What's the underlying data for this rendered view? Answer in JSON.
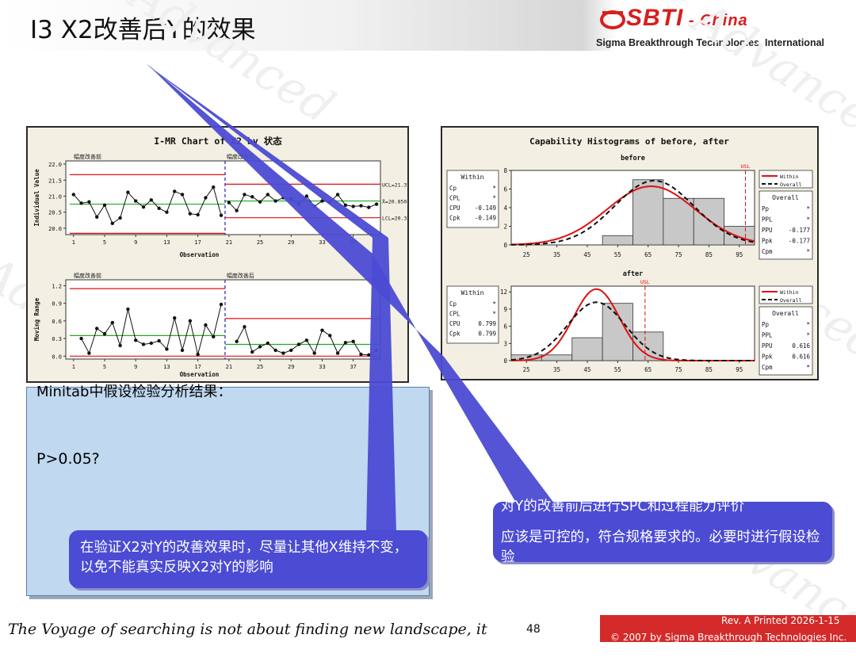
{
  "header": {
    "title": "I3  X2改善后Y的效果",
    "logo_brand": "SBTI",
    "logo_suffix": " - China",
    "logo_subtitle": "Sigma Breakthrough Technologies, International"
  },
  "watermark_text": "Advanced",
  "chart_data": [
    {
      "type": "line",
      "title": "I-MR Chart of X2 by 状态",
      "panels": [
        {
          "name": "individual",
          "ylabel": "Individual Value",
          "xlabel": "Observation",
          "ylim": [
            19.8,
            22.1
          ],
          "yticks": [
            20.0,
            20.5,
            21.0,
            21.5,
            22.0
          ],
          "xticks": [
            1,
            5,
            9,
            13,
            17,
            21,
            25,
            29,
            33,
            37
          ],
          "stage_labels": [
            "幅度改善前",
            "幅度改善后"
          ],
          "stage_split": 20.5,
          "x": [
            1,
            2,
            3,
            4,
            5,
            6,
            7,
            8,
            9,
            10,
            11,
            12,
            13,
            14,
            15,
            16,
            17,
            18,
            19,
            20,
            21,
            22,
            23,
            24,
            25,
            26,
            27,
            28,
            29,
            30,
            31,
            32,
            33,
            34,
            35,
            36,
            37,
            38,
            39,
            40
          ],
          "values": [
            21.05,
            20.78,
            20.82,
            20.35,
            20.72,
            20.15,
            20.32,
            21.12,
            20.85,
            20.66,
            20.88,
            20.62,
            20.5,
            21.15,
            21.05,
            20.45,
            20.42,
            20.95,
            21.28,
            20.4,
            20.8,
            20.55,
            21.05,
            20.98,
            20.82,
            21.05,
            20.85,
            20.95,
            20.92,
            20.75,
            21.0,
            20.68,
            20.85,
            20.82,
            21.05,
            20.72,
            20.68,
            20.7,
            20.65,
            20.75
          ],
          "control_limits": {
            "before": {
              "ucl": 21.67,
              "center": 20.75,
              "lcl": 19.84
            },
            "after": {
              "ucl": 21.373,
              "center": 20.85,
              "lcl": 20.327
            }
          },
          "limit_labels": [
            "UCL=21.373",
            "X̄=20.850",
            "LCL=20.327"
          ]
        },
        {
          "name": "moving_range",
          "ylabel": "Moving Range",
          "xlabel": "Observation",
          "ylim": [
            -0.05,
            1.3
          ],
          "yticks": [
            0.0,
            0.3,
            0.6,
            0.9,
            1.2
          ],
          "xticks": [
            1,
            5,
            9,
            13,
            17,
            21,
            25,
            29,
            33,
            37
          ],
          "stage_labels": [
            "幅度改善前",
            "幅度改善后"
          ],
          "stage_split": 20.5,
          "x": [
            2,
            3,
            4,
            5,
            6,
            7,
            8,
            9,
            10,
            11,
            12,
            13,
            14,
            15,
            16,
            17,
            18,
            19,
            20,
            22,
            23,
            24,
            25,
            26,
            27,
            28,
            29,
            30,
            31,
            32,
            33,
            34,
            35,
            36,
            37,
            38,
            39,
            40
          ],
          "values": [
            0.3,
            0.05,
            0.47,
            0.38,
            0.57,
            0.18,
            0.8,
            0.27,
            0.2,
            0.22,
            0.26,
            0.12,
            0.65,
            0.1,
            0.6,
            0.03,
            0.53,
            0.33,
            0.88,
            0.25,
            0.5,
            0.07,
            0.16,
            0.22,
            0.1,
            0.05,
            0.1,
            0.2,
            0.27,
            0.05,
            0.44,
            0.35,
            0.05,
            0.23,
            0.25,
            0.03,
            0.02,
            0.1
          ],
          "control_limits": {
            "before": {
              "ucl": 1.15,
              "center": 0.35,
              "lcl": 0.0
            },
            "after": {
              "ucl": 0.64,
              "center": 0.2,
              "lcl": 0.0
            }
          }
        }
      ]
    },
    {
      "type": "bar",
      "title": "Capability Histograms of before, after",
      "xticks": [
        25,
        35,
        45,
        55,
        65,
        75,
        85,
        95
      ],
      "xlim": [
        20,
        100
      ],
      "panels": [
        {
          "name": "before",
          "usl": 97,
          "usl_label": "USL",
          "ylim": [
            0,
            8
          ],
          "yticks": [
            0,
            2,
            4,
            6,
            8
          ],
          "bin_edges": [
            40,
            50,
            60,
            70,
            80,
            90,
            100
          ],
          "counts": [
            0,
            1,
            7,
            5,
            5,
            2
          ],
          "within_stats": [
            [
              "Cp",
              "*"
            ],
            [
              "CPL",
              "*"
            ],
            [
              "CPU",
              "-0.149"
            ],
            [
              "Cpk",
              "-0.149"
            ]
          ],
          "overall_stats": [
            [
              "Pp",
              "*"
            ],
            [
              "PPL",
              "*"
            ],
            [
              "PPU",
              "-0.177"
            ],
            [
              "Ppk",
              "-0.177"
            ],
            [
              "Cpm",
              "*"
            ]
          ],
          "within_curve": {
            "mean": 66,
            "sd": 14.5,
            "peak": 6.3
          },
          "overall_curve": {
            "mean": 67,
            "sd": 13,
            "peak": 6.9
          }
        },
        {
          "name": "after",
          "usl": 64,
          "usl_label": "USL",
          "ylim": [
            0,
            13
          ],
          "yticks": [
            0,
            3,
            6,
            9,
            12
          ],
          "bin_edges": [
            20,
            30,
            40,
            50,
            60,
            70
          ],
          "counts": [
            1,
            1,
            4,
            10,
            5
          ],
          "within_stats": [
            [
              "Cp",
              "*"
            ],
            [
              "CPL",
              "*"
            ],
            [
              "CPU",
              "0.799"
            ],
            [
              "Cpk",
              "0.799"
            ]
          ],
          "overall_stats": [
            [
              "Pp",
              "*"
            ],
            [
              "PPL",
              "*"
            ],
            [
              "PPU",
              "0.616"
            ],
            [
              "Ppk",
              "0.616"
            ],
            [
              "Cpm",
              "*"
            ]
          ],
          "within_curve": {
            "mean": 48,
            "sd": 7.5,
            "peak": 12.5
          },
          "overall_curve": {
            "mean": 48,
            "sd": 9.5,
            "peak": 10.2
          }
        }
      ],
      "legend": {
        "within_label": "Within",
        "overall_label": "Overall",
        "line_within": "Within",
        "line_overall": "Overall"
      }
    }
  ],
  "colors": {
    "within_line": "#e01010",
    "overall_line": "#111111",
    "center_line": "#22aa22",
    "limit_line": "#e01010",
    "stage_line": "#2020c0",
    "bar_fill": "#c8c8c8",
    "callout": "#4b4bd3",
    "footer_red": "#d42a2a"
  },
  "analysis_box": {
    "title": "Minitab中假设检验分析结果：",
    "text": "P>0.05?"
  },
  "callout_left": {
    "text": "在验证X2对Y的改善效果时，尽量让其他X维持不变，以免不能真实反映X2对Y的影响"
  },
  "callout_right": {
    "title": "对Y的改善前后进行SPC和过程能力评价",
    "text": "应该是可控的，符合规格要求的。必要时进行假设检验"
  },
  "footer": {
    "tagline": "The Voyage of searching is not about finding new landscape, it is",
    "page_number": "48",
    "revision": "Rev. A   Printed 2026-1-15",
    "copyright": "© 2007 by Sigma Breakthrough Technologies Inc."
  }
}
